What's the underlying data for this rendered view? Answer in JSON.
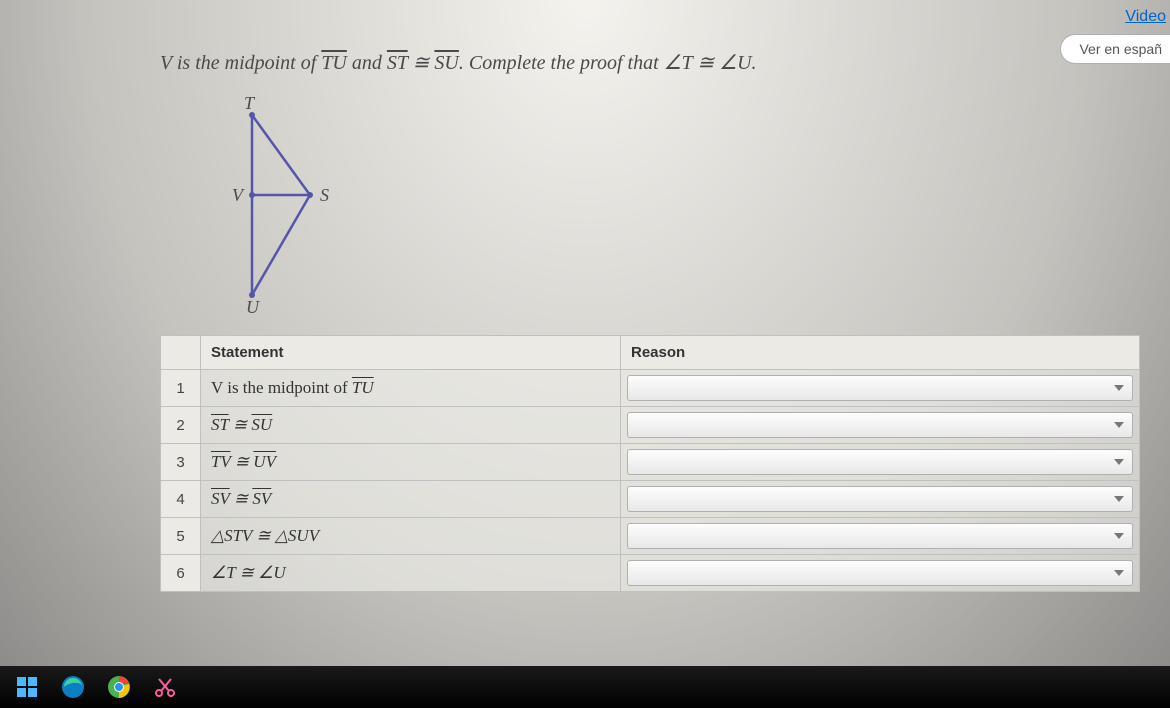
{
  "topLinks": {
    "video": "Video",
    "langButton": "Ver en españ"
  },
  "problem": {
    "prefix": "V is the midpoint of ",
    "seg1": "TU",
    "mid1": " and ",
    "seg2": "ST",
    "cong": " ≅ ",
    "seg3": "SU",
    "mid2": ". Complete the proof that ∠",
    "ang1": "T",
    "cong2": " ≅ ∠",
    "ang2": "U",
    "suffix": "."
  },
  "diagram": {
    "labels": {
      "T": "T",
      "V": "V",
      "S": "S",
      "U": "U"
    }
  },
  "table": {
    "headers": {
      "statement": "Statement",
      "reason": "Reason"
    },
    "rows": [
      {
        "n": "1",
        "stmt_prefix": "V is the midpoint of ",
        "stmt_seg": "TU"
      },
      {
        "n": "2",
        "stmt_seg1": "ST",
        "stmt_mid": " ≅ ",
        "stmt_seg2": "SU"
      },
      {
        "n": "3",
        "stmt_seg1": "TV",
        "stmt_mid": " ≅ ",
        "stmt_seg2": "UV"
      },
      {
        "n": "4",
        "stmt_seg1": "SV",
        "stmt_mid": " ≅ ",
        "stmt_seg2": "SV"
      },
      {
        "n": "5",
        "stmt_plain": "△STV ≅ △SUV"
      },
      {
        "n": "6",
        "stmt_plain": "∠T ≅ ∠U"
      }
    ]
  }
}
